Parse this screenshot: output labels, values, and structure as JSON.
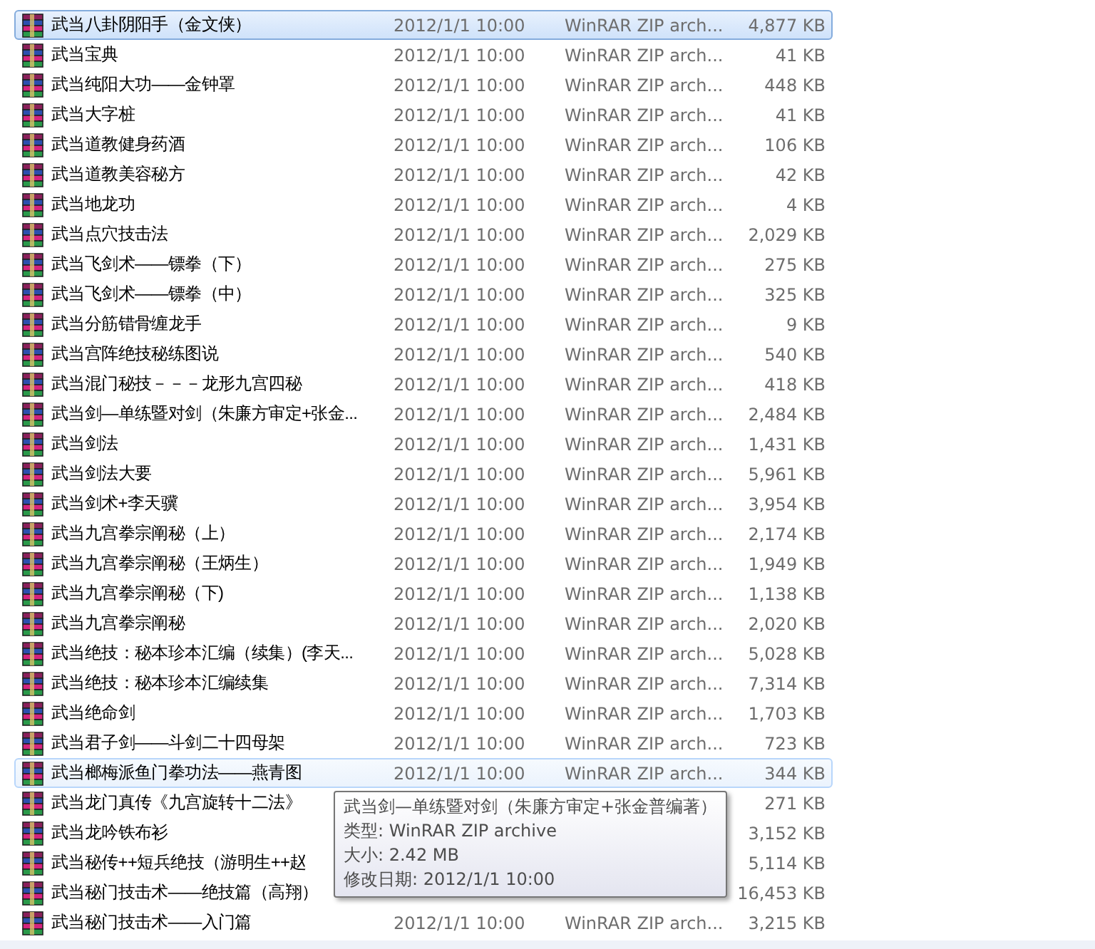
{
  "files": [
    {
      "name": "武当八卦阴阳手（金文侠）",
      "date": "2012/1/1 10:00",
      "type": "WinRAR ZIP arch...",
      "size": "4,877 KB",
      "selected": true,
      "hovered": false
    },
    {
      "name": "武当宝典",
      "date": "2012/1/1 10:00",
      "type": "WinRAR ZIP arch...",
      "size": "41 KB",
      "selected": false,
      "hovered": false
    },
    {
      "name": "武当纯阳大功——金钟罩",
      "date": "2012/1/1 10:00",
      "type": "WinRAR ZIP arch...",
      "size": "448 KB",
      "selected": false,
      "hovered": false
    },
    {
      "name": "武当大字桩",
      "date": "2012/1/1 10:00",
      "type": "WinRAR ZIP arch...",
      "size": "41 KB",
      "selected": false,
      "hovered": false
    },
    {
      "name": "武当道教健身药酒",
      "date": "2012/1/1 10:00",
      "type": "WinRAR ZIP arch...",
      "size": "106 KB",
      "selected": false,
      "hovered": false
    },
    {
      "name": "武当道教美容秘方",
      "date": "2012/1/1 10:00",
      "type": "WinRAR ZIP arch...",
      "size": "42 KB",
      "selected": false,
      "hovered": false
    },
    {
      "name": "武当地龙功",
      "date": "2012/1/1 10:00",
      "type": "WinRAR ZIP arch...",
      "size": "4 KB",
      "selected": false,
      "hovered": false
    },
    {
      "name": "武当点穴技击法",
      "date": "2012/1/1 10:00",
      "type": "WinRAR ZIP arch...",
      "size": "2,029 KB",
      "selected": false,
      "hovered": false
    },
    {
      "name": "武当飞剑术——镖拳（下）",
      "date": "2012/1/1 10:00",
      "type": "WinRAR ZIP arch...",
      "size": "275 KB",
      "selected": false,
      "hovered": false
    },
    {
      "name": "武当飞剑术——镖拳（中）",
      "date": "2012/1/1 10:00",
      "type": "WinRAR ZIP arch...",
      "size": "325 KB",
      "selected": false,
      "hovered": false
    },
    {
      "name": "武当分筋错骨缠龙手",
      "date": "2012/1/1 10:00",
      "type": "WinRAR ZIP arch...",
      "size": "9 KB",
      "selected": false,
      "hovered": false
    },
    {
      "name": "武当宫阵绝技秘练图说",
      "date": "2012/1/1 10:00",
      "type": "WinRAR ZIP arch...",
      "size": "540 KB",
      "selected": false,
      "hovered": false
    },
    {
      "name": "武当混门秘技－－－龙形九宫四秘",
      "date": "2012/1/1 10:00",
      "type": "WinRAR ZIP arch...",
      "size": "418 KB",
      "selected": false,
      "hovered": false
    },
    {
      "name": "武当剑—单练暨对剑（朱廉方审定+张金...",
      "date": "2012/1/1 10:00",
      "type": "WinRAR ZIP arch...",
      "size": "2,484 KB",
      "selected": false,
      "hovered": false
    },
    {
      "name": "武当剑法",
      "date": "2012/1/1 10:00",
      "type": "WinRAR ZIP arch...",
      "size": "1,431 KB",
      "selected": false,
      "hovered": false
    },
    {
      "name": "武当剑法大要",
      "date": "2012/1/1 10:00",
      "type": "WinRAR ZIP arch...",
      "size": "5,961 KB",
      "selected": false,
      "hovered": false
    },
    {
      "name": "武当剑术+李天骥",
      "date": "2012/1/1 10:00",
      "type": "WinRAR ZIP arch...",
      "size": "3,954 KB",
      "selected": false,
      "hovered": false
    },
    {
      "name": "武当九宫拳宗阐秘（上）",
      "date": "2012/1/1 10:00",
      "type": "WinRAR ZIP arch...",
      "size": "2,174 KB",
      "selected": false,
      "hovered": false
    },
    {
      "name": "武当九宫拳宗阐秘（王炳生）",
      "date": "2012/1/1 10:00",
      "type": "WinRAR ZIP arch...",
      "size": "1,949 KB",
      "selected": false,
      "hovered": false
    },
    {
      "name": "武当九宫拳宗阐秘（下)",
      "date": "2012/1/1 10:00",
      "type": "WinRAR ZIP arch...",
      "size": "1,138 KB",
      "selected": false,
      "hovered": false
    },
    {
      "name": "武当九宫拳宗阐秘",
      "date": "2012/1/1 10:00",
      "type": "WinRAR ZIP arch...",
      "size": "2,020 KB",
      "selected": false,
      "hovered": false
    },
    {
      "name": "武当绝技：秘本珍本汇编（续集）(李天...",
      "date": "2012/1/1 10:00",
      "type": "WinRAR ZIP arch...",
      "size": "5,028 KB",
      "selected": false,
      "hovered": false
    },
    {
      "name": "武当绝技：秘本珍本汇编续集",
      "date": "2012/1/1 10:00",
      "type": "WinRAR ZIP arch...",
      "size": "7,314 KB",
      "selected": false,
      "hovered": false
    },
    {
      "name": "武当绝命剑",
      "date": "2012/1/1 10:00",
      "type": "WinRAR ZIP arch...",
      "size": "1,703 KB",
      "selected": false,
      "hovered": false
    },
    {
      "name": "武当君子剑——斗剑二十四母架",
      "date": "2012/1/1 10:00",
      "type": "WinRAR ZIP arch...",
      "size": "723 KB",
      "selected": false,
      "hovered": false
    },
    {
      "name": "武当榔梅派鱼门拳功法——燕青图",
      "date": "2012/1/1 10:00",
      "type": "WinRAR ZIP arch...",
      "size": "344 KB",
      "selected": false,
      "hovered": true
    },
    {
      "name": "武当龙门真传《九宫旋转十二法》",
      "size": "271 KB",
      "selected": false,
      "hovered": false
    },
    {
      "name": "武当龙吟铁布衫",
      "size": "3,152 KB",
      "selected": false,
      "hovered": false
    },
    {
      "name": "武当秘传++短兵绝技（游明生++赵",
      "size": "5,114 KB",
      "selected": false,
      "hovered": false
    },
    {
      "name": "武当秘门技击术——绝技篇（高翔）",
      "size": "16,453 KB",
      "selected": false,
      "hovered": false
    },
    {
      "name": "武当秘门技击术——入门篇",
      "date": "2012/1/1 10:00",
      "type": "WinRAR ZIP arch...",
      "size": "3,215 KB",
      "selected": false,
      "hovered": false
    }
  ],
  "tooltip": {
    "title": "武当剑—单练暨对剑（朱廉方审定+张金普编著）",
    "lines": [
      "类型: WinRAR ZIP archive",
      "大小: 2.42 MB",
      "修改日期: 2012/1/1 10:00"
    ]
  }
}
